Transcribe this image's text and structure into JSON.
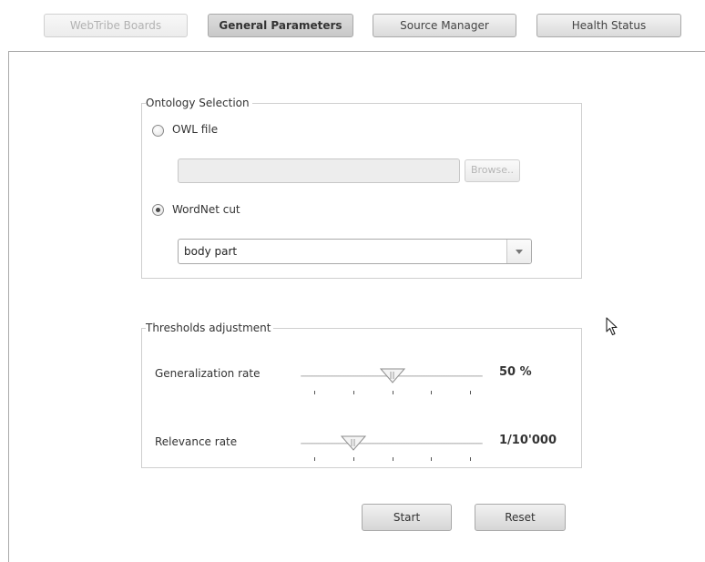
{
  "tabs": [
    {
      "label": "WebTribe Boards",
      "state": "disabled"
    },
    {
      "label": "General Parameters",
      "state": "active"
    },
    {
      "label": "Source Manager",
      "state": "normal"
    },
    {
      "label": "Health Status",
      "state": "normal"
    }
  ],
  "ontology": {
    "legend": "Ontology Selection",
    "owl_label": "OWL file",
    "owl_selected": false,
    "owl_path_value": "",
    "browse_label": "Browse..",
    "wordnet_label": "WordNet cut",
    "wordnet_selected": true,
    "wordnet_value": "body part"
  },
  "thresholds": {
    "legend": "Thresholds adjustment",
    "generalization_label": "Generalization rate",
    "generalization_value": "50 %",
    "generalization_position": 0.5,
    "relevance_label": "Relevance rate",
    "relevance_value": "1/10'000",
    "relevance_position": 0.25,
    "tick_count": 5
  },
  "actions": {
    "start_label": "Start",
    "reset_label": "Reset"
  }
}
